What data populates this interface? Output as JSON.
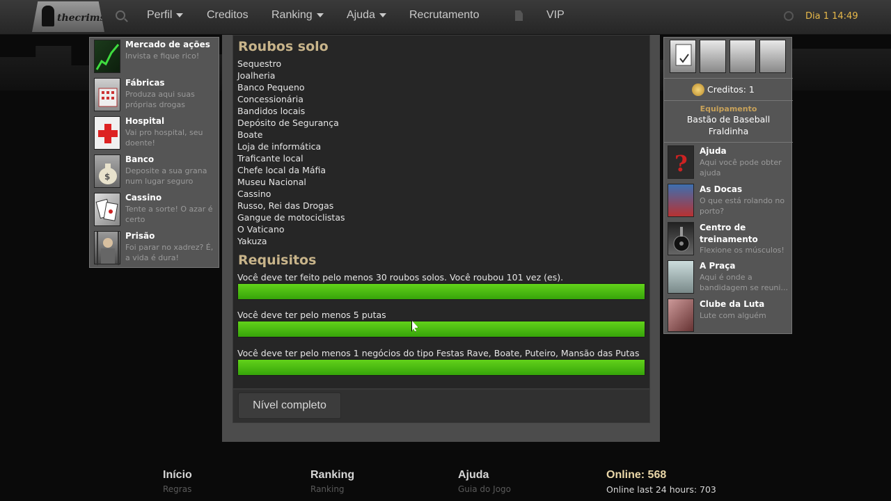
{
  "header": {
    "logo_text": "thecrims",
    "nav": [
      {
        "label": "Perfil",
        "dropdown": true
      },
      {
        "label": "Creditos",
        "dropdown": false
      },
      {
        "label": "Ranking",
        "dropdown": true
      },
      {
        "label": "Ajuda",
        "dropdown": true
      },
      {
        "label": "Recrutamento",
        "dropdown": false
      },
      {
        "label": "VIP",
        "dropdown": false
      }
    ],
    "clock": "Dia 1 14:49"
  },
  "left_menu": [
    {
      "title": "Mercado de ações",
      "desc": "Invista e fique rico!",
      "icon": "stock-chart-icon"
    },
    {
      "title": "Fábricas",
      "desc": "Produza aqui suas próprias drogas",
      "icon": "factory-icon"
    },
    {
      "title": "Hospital",
      "desc": "Vai pro hospital, seu doente!",
      "icon": "hospital-cross-icon"
    },
    {
      "title": "Banco",
      "desc": "Deposite a sua grana num lugar seguro",
      "icon": "money-bag-icon"
    },
    {
      "title": "Cassino",
      "desc": "Tente a sorte! O azar é certo",
      "icon": "playing-cards-icon"
    },
    {
      "title": "Prisão",
      "desc": "Foi parar no xadrez? É, a vida é dura!",
      "icon": "prisoner-icon"
    }
  ],
  "main": {
    "solo_title": "Roubos solo",
    "robberies": [
      "Sequestro",
      "Joalheria",
      "Banco Pequeno",
      "Concessionária",
      "Bandidos locais",
      "Depósito de Segurança",
      "Boate",
      "Loja de informática",
      "Traficante local",
      "Chefe local da Máfia",
      "Museu Nacional",
      "Cassino",
      "Russo, Rei das Drogas",
      "Gangue de motociclistas",
      "O Vaticano",
      "Yakuza"
    ],
    "req_title": "Requisitos",
    "requirements": [
      {
        "text": "Você deve ter feito pelo menos 30 roubos solos. Você roubou 101 vez (es).",
        "progress": 1.0
      },
      {
        "text": "Você deve ter pelo menos 5 putas",
        "progress": 1.0
      },
      {
        "text": "Você deve ter pelo menos 1 negócios do tipo Festas Rave, Boate, Puteiro, Mansão das Putas",
        "progress": 1.0
      }
    ],
    "complete_button": "Nível completo"
  },
  "right_panel": {
    "icons": [
      "checklist-icon",
      "landscape-icon",
      "gang-photo-icon",
      "crowd-photo-icon"
    ],
    "credits": "Creditos: 1",
    "equipment_label": "Equipamento",
    "equipment": [
      "Bastão de Baseball",
      "Fraldinha"
    ],
    "items": [
      {
        "title": "Ajuda",
        "desc": "Aqui você pode obter ajuda",
        "icon": "question-mark-icon"
      },
      {
        "title": "As Docas",
        "desc": "O que está rolando no porto?",
        "icon": "docks-ship-icon"
      },
      {
        "title": "Centro de treinamento",
        "desc": "Flexione os músculos!",
        "icon": "weights-icon"
      },
      {
        "title": "A Praça",
        "desc": "Aqui é onde a bandidagem se reuni...",
        "icon": "plaza-icon"
      },
      {
        "title": "Clube da Luta",
        "desc": "Lute com alguém",
        "icon": "fight-icon"
      }
    ]
  },
  "footer": {
    "cols": [
      {
        "head": "Início",
        "sub": "Regras"
      },
      {
        "head": "Ranking",
        "sub": "Ranking"
      },
      {
        "head": "Ajuda",
        "sub": "Guia do Jogo"
      }
    ],
    "online": "Online: 568",
    "online_24h": "Online last 24 hours: 703"
  },
  "colors": {
    "accent_gold": "#c8b48a",
    "progress_green": "#4cbf12",
    "clock": "#e8b94a"
  }
}
